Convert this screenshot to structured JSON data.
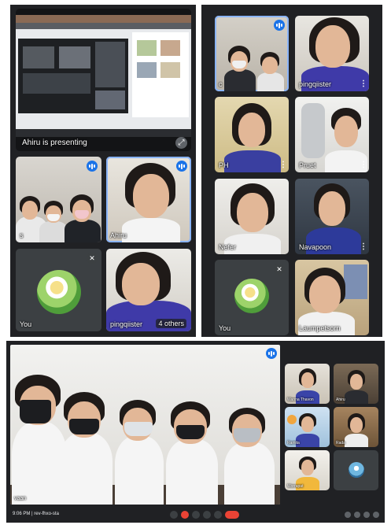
{
  "top_left": {
    "presenter_text": "Ahiru is presenting",
    "tiles": [
      {
        "label": "s"
      },
      {
        "label": "Ahiru"
      },
      {
        "label": "You"
      },
      {
        "label": "pingqiister",
        "extra": "4 others"
      }
    ]
  },
  "top_right": {
    "tiles": [
      {
        "label": "c"
      },
      {
        "label": "pingqiister"
      },
      {
        "label": "PH"
      },
      {
        "label": "Pruet"
      },
      {
        "label": "Nefer"
      },
      {
        "label": "Navapoon"
      },
      {
        "label": "You"
      },
      {
        "label": "Laumpetsorn"
      }
    ]
  },
  "bottom": {
    "main_label": "vaan",
    "meeting_info": "9:06 PM | rev-fhxo-sta",
    "thumb_labels": [
      "Wanna Thavon",
      "Ahiru",
      "Ramita",
      "Rada",
      "Worrapat",
      ""
    ]
  },
  "colors": {
    "panel_bg": "#202124",
    "tile_bg": "#3c4043",
    "accent": "#1a73e8",
    "end_call": "#ea4335"
  },
  "icons": [
    "mic-off-icon",
    "speaking-indicator-icon",
    "more-options-icon",
    "fullscreen-icon",
    "avatar-icon",
    "end-call-icon"
  ]
}
